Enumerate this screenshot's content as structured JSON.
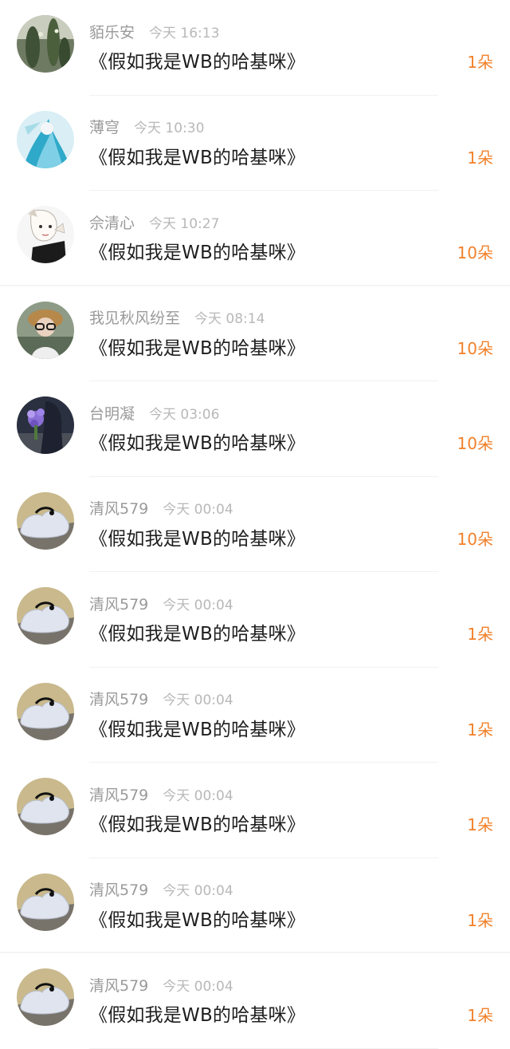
{
  "colors": {
    "accent": "#f2812b",
    "username": "#9a9a9a",
    "timestamp": "#b8b8b8",
    "text": "#1e1e1e"
  },
  "gift_list": [
    {
      "username": "貊乐安",
      "time": "今天 16:13",
      "gift": "《假如我是WB的哈基咪》",
      "count": "1朵",
      "avatar_icon": "cactus-avatar"
    },
    {
      "username": "薄穹",
      "time": "今天 10:30",
      "gift": "《假如我是WB的哈基咪》",
      "count": "1朵",
      "avatar_icon": "anime-blue-avatar"
    },
    {
      "username": "佘清心",
      "time": "今天 10:27",
      "gift": "《假如我是WB的哈基咪》",
      "count": "10朵",
      "avatar_icon": "sketch-girl-avatar"
    },
    {
      "username": "我见秋风纷至",
      "time": "今天 08:14",
      "gift": "《假如我是WB的哈基咪》",
      "count": "10朵",
      "avatar_icon": "glasses-person-avatar"
    },
    {
      "username": "台明凝",
      "time": "今天 03:06",
      "gift": "《假如我是WB的哈基咪》",
      "count": "10朵",
      "avatar_icon": "bouquet-avatar"
    },
    {
      "username": "清风579",
      "time": "今天 00:04",
      "gift": "《假如我是WB的哈基咪》",
      "count": "10朵",
      "avatar_icon": "white-figure-avatar"
    },
    {
      "username": "清风579",
      "time": "今天 00:04",
      "gift": "《假如我是WB的哈基咪》",
      "count": "1朵",
      "avatar_icon": "white-figure-avatar"
    },
    {
      "username": "清风579",
      "time": "今天 00:04",
      "gift": "《假如我是WB的哈基咪》",
      "count": "1朵",
      "avatar_icon": "white-figure-avatar"
    },
    {
      "username": "清风579",
      "time": "今天 00:04",
      "gift": "《假如我是WB的哈基咪》",
      "count": "1朵",
      "avatar_icon": "white-figure-avatar"
    },
    {
      "username": "清风579",
      "time": "今天 00:04",
      "gift": "《假如我是WB的哈基咪》",
      "count": "1朵",
      "avatar_icon": "white-figure-avatar"
    },
    {
      "username": "清风579",
      "time": "今天 00:04",
      "gift": "《假如我是WB的哈基咪》",
      "count": "1朵",
      "avatar_icon": "white-figure-avatar"
    }
  ]
}
